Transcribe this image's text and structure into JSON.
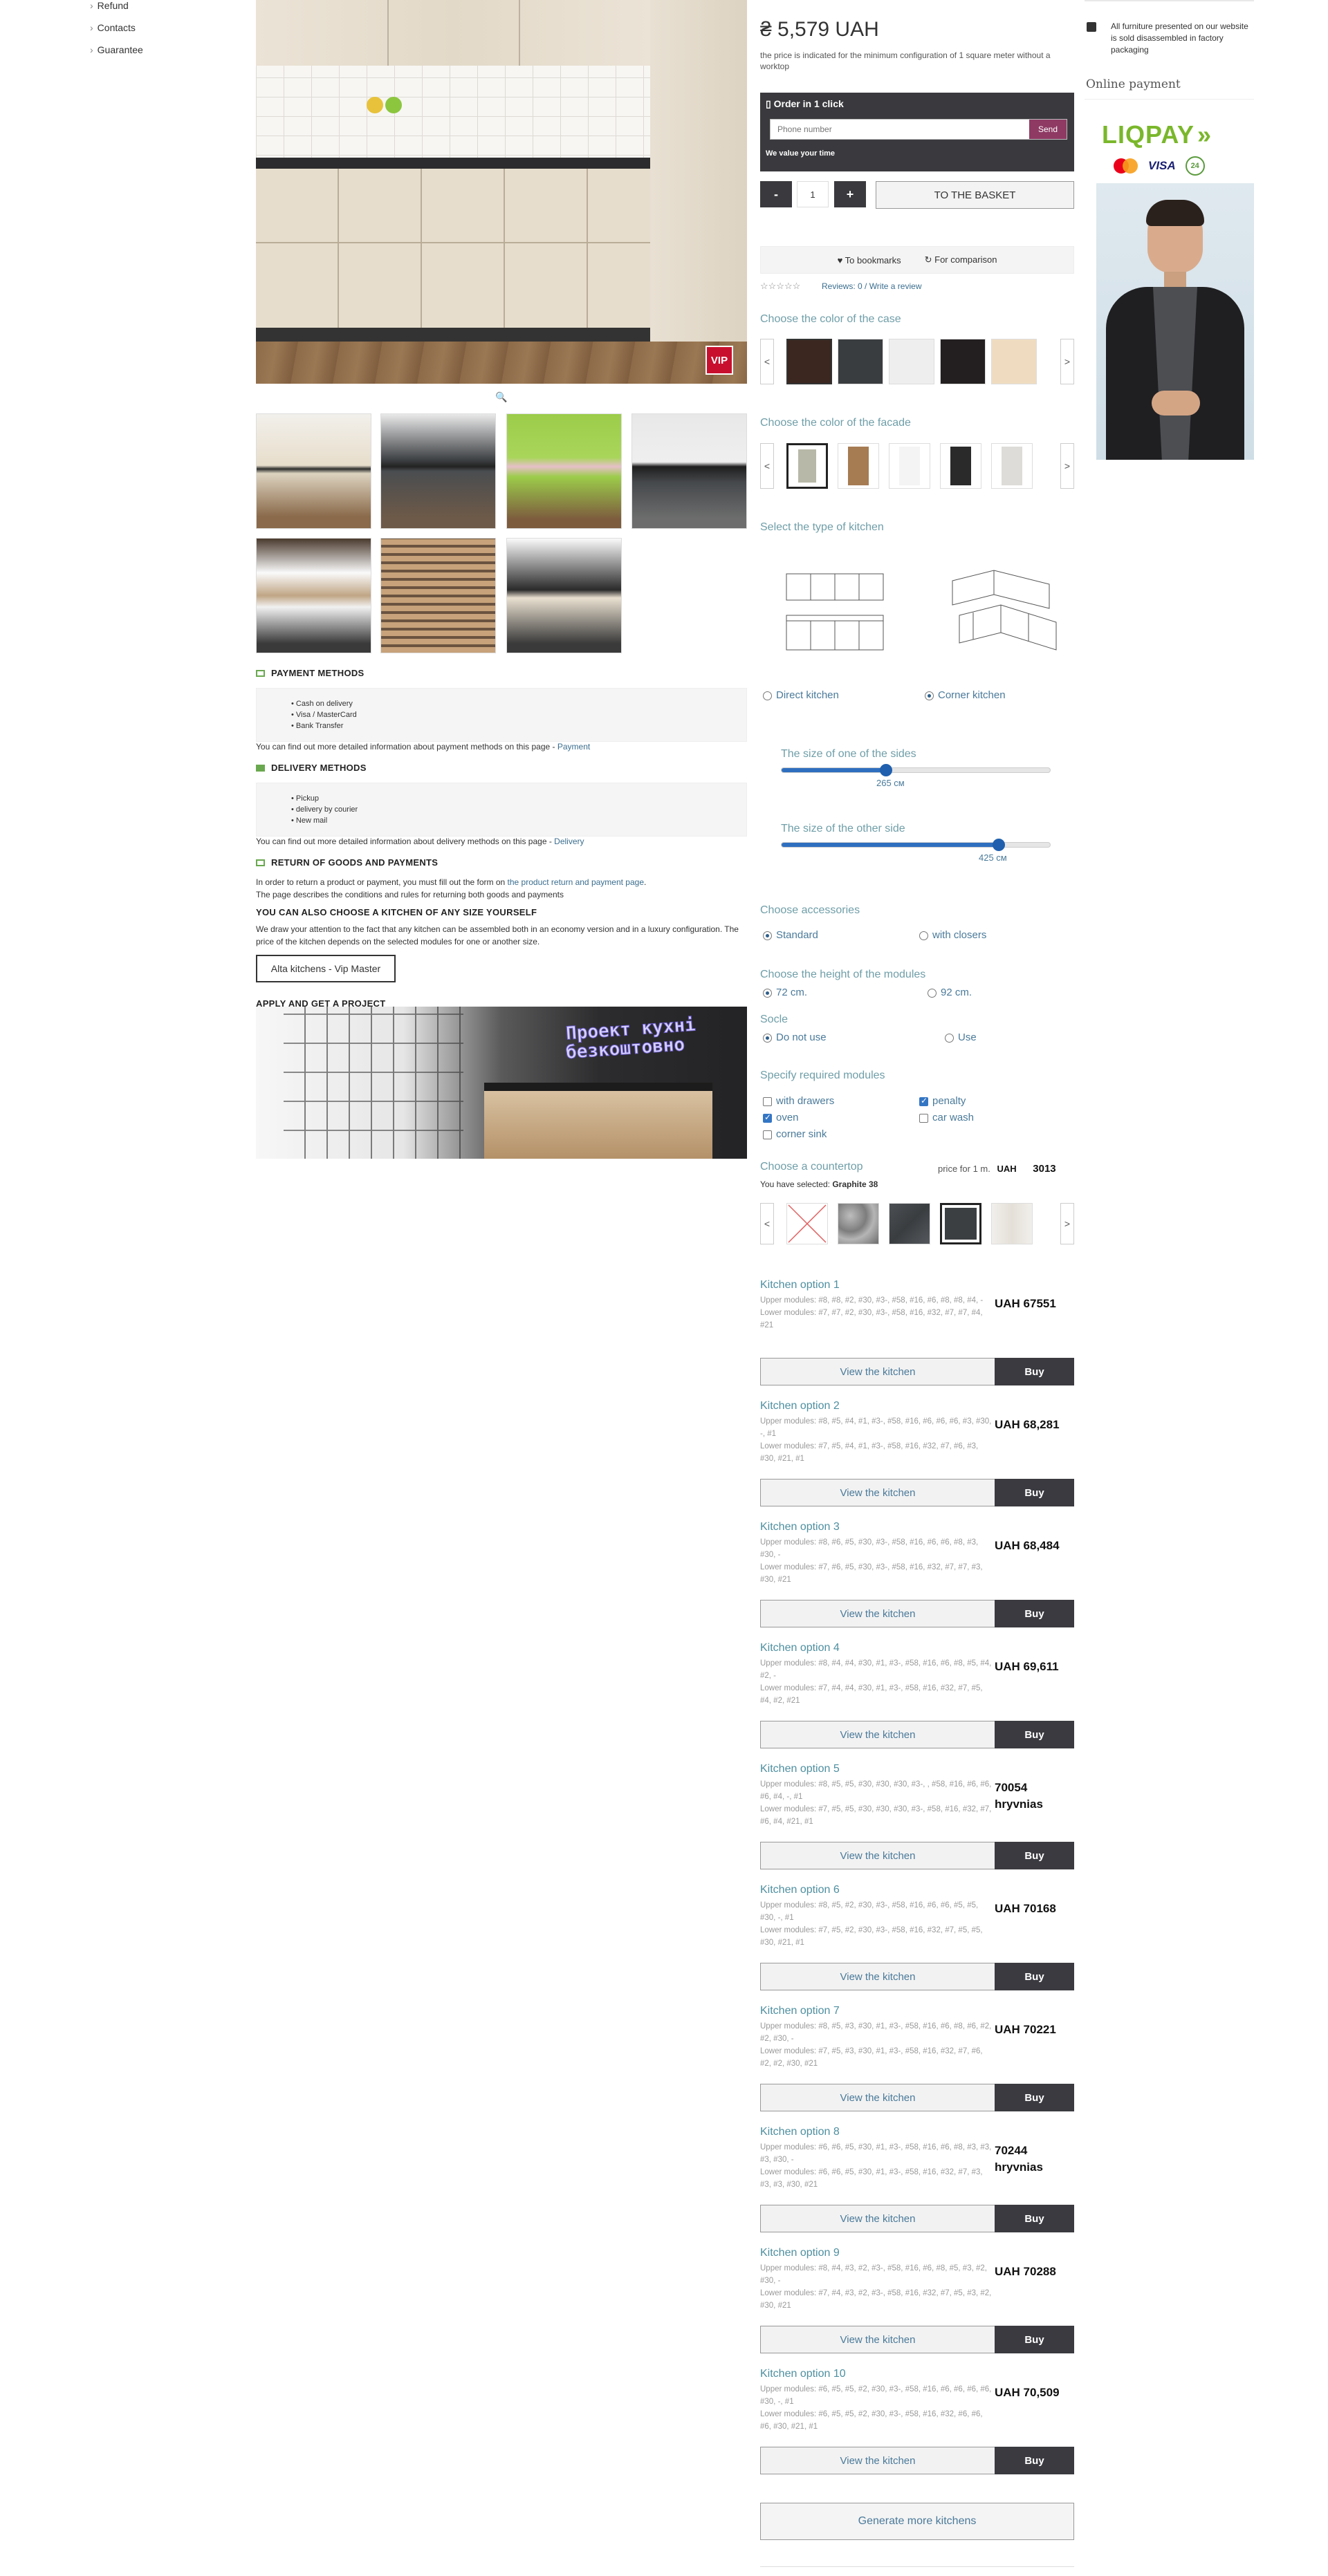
{
  "sidebar": {
    "links": [
      "Refund",
      "Contacts",
      "Guarantee"
    ]
  },
  "gallery": {
    "badge": "VIP",
    "thumbs_count": 7
  },
  "info": {
    "payment_title": "PAYMENT METHODS",
    "payment_items": [
      "Cash on delivery",
      "Visa / MasterCard",
      "Bank Transfer"
    ],
    "payment_note": "You can find out more detailed information about payment methods on this page -",
    "payment_link": "Payment",
    "delivery_title": "DELIVERY METHODS",
    "delivery_items": [
      "Pickup",
      "delivery by courier",
      "New mail"
    ],
    "delivery_note": "You can find out more detailed information about delivery methods on this page -",
    "delivery_link": "Delivery",
    "return_title": "RETURN OF GOODS AND PAYMENTS",
    "return_text1": "In order to return a product or payment, you must fill out the form on",
    "return_link": "the product return and payment page",
    "return_text2": "The page describes the conditions and rules for returning both goods and payments",
    "any_size_title": "YOU CAN ALSO CHOOSE A KITCHEN OF ANY SIZE YOURSELF",
    "any_size_text": "We draw your attention to the fact that any kitchen can be assembled both in an economy version and in a luxury configuration. The price of the kitchen depends on the selected modules for one or another size.",
    "any_size_button": "Alta kitchens - Vip Master",
    "apply_title": "APPLY AND GET A PROJECT",
    "banner_line1": "Проект кухні",
    "banner_line2": "безкоштовно"
  },
  "product": {
    "price": "₴ 5,579 UAH",
    "price_note": "the price is indicated for the minimum configuration of 1 square meter without a worktop",
    "order_title": "Order in 1 click",
    "phone_placeholder": "Phone number",
    "send_label": "Send",
    "value_time": "We value your time",
    "minus": "-",
    "qty": "1",
    "plus": "+",
    "basket": "TO THE BASKET",
    "bookmarks": "To bookmarks",
    "comparison": "For comparison",
    "stars": "☆☆☆☆☆",
    "reviews": "Reviews: 0 / Write a review"
  },
  "colors": {
    "case_title": "Choose the color of the case",
    "case_swatches": [
      "#3b2620",
      "#3a3d3f",
      "#eeeeee",
      "#231f20",
      "#efdcc0"
    ],
    "facade_title": "Choose the color of the facade",
    "facade_swatches": [
      "#b8b8a8",
      "#a67c52",
      "#f4f4f4",
      "#2a2a2a",
      "#dedcd8"
    ],
    "prev": "<",
    "next": ">"
  },
  "kitchen_type": {
    "title": "Select the type of kitchen",
    "direct": "Direct kitchen",
    "corner": "Corner kitchen"
  },
  "sizes": {
    "side1_title": "The size of one of the sides",
    "side1_value": "265 см",
    "side1_level": 0.39,
    "side2_title": "The size of the other side",
    "side2_value": "425 см",
    "side2_level": 0.81
  },
  "accessories": {
    "title": "Choose accessories",
    "standard": "Standard",
    "closers": "with closers"
  },
  "height": {
    "title": "Choose the height of the modules",
    "h72": "72 cm.",
    "h92": "92 cm."
  },
  "socle": {
    "title": "Socle",
    "no": "Do not use",
    "use": "Use"
  },
  "modules": {
    "title": "Specify required modules",
    "items": [
      {
        "label": "with drawers",
        "checked": false
      },
      {
        "label": "penalty",
        "checked": true
      },
      {
        "label": "oven",
        "checked": true
      },
      {
        "label": "car wash",
        "checked": false
      },
      {
        "label": "corner sink",
        "checked": false
      }
    ]
  },
  "countertop": {
    "title": "Choose a countertop",
    "price_label": "price for 1 m.",
    "currency": "UAH",
    "price": "3013",
    "selected_label": "You have selected",
    "selected": "Graphite 38"
  },
  "kitchens": [
    {
      "title": "Kitchen option 1",
      "upper": "Upper modules: #8, #8, #2, #30, #3-, #58, #16, #6, #8, #8, #4, -",
      "lower": "Lower modules: #7, #7, #2, #30, #3-, #58, #16, #32, #7, #7, #4, #21",
      "price": "UAH 67551"
    },
    {
      "title": "Kitchen option 2",
      "upper": "Upper modules: #8, #5, #4, #1, #3-, #58, #16, #6, #6, #6, #3, #30, -, #1",
      "lower": "Lower modules: #7, #5, #4, #1, #3-, #58, #16, #32, #7, #6, #3, #30, #21, #1",
      "price": "UAH 68,281"
    },
    {
      "title": "Kitchen option 3",
      "upper": "Upper modules: #8, #6, #5, #30, #3-, #58, #16, #6, #6, #8, #3, #30, -",
      "lower": "Lower modules: #7, #6, #5, #30, #3-, #58, #16, #32, #7, #7, #3, #30, #21",
      "price": "UAH 68,484"
    },
    {
      "title": "Kitchen option 4",
      "upper": "Upper modules: #8, #4, #4, #30, #1, #3-, #58, #16, #6, #8, #5, #4, #2, -",
      "lower": "Lower modules: #7, #4, #4, #30, #1, #3-, #58, #16, #32, #7, #5, #4, #2, #21",
      "price": "UAH 69,611"
    },
    {
      "title": "Kitchen option 5",
      "upper": "Upper modules: #8, #5, #5, #30, #30, #30, #3-, , #58, #16, #6, #6, #6, #4, -, #1",
      "lower": "Lower modules: #7, #5, #5, #30, #30, #30, #3-, #58, #16, #32, #7, #6, #4, #21, #1",
      "price": "70054 hryvnias"
    },
    {
      "title": "Kitchen option 6",
      "upper": "Upper modules: #8, #5, #2, #30, #3-, #58, #16, #6, #6, #5, #5, #30, -, #1",
      "lower": "Lower modules: #7, #5, #2, #30, #3-, #58, #16, #32, #7, #5, #5, #30, #21, #1",
      "price": "UAH 70168"
    },
    {
      "title": "Kitchen option 7",
      "upper": "Upper modules: #8, #5, #3, #30, #1, #3-, #58, #16, #6, #8, #6, #2, #2, #30, -",
      "lower": "Lower modules: #7, #5, #3, #30, #1, #3-, #58, #16, #32, #7, #6, #2, #2, #30, #21",
      "price": "UAH 70221"
    },
    {
      "title": "Kitchen option 8",
      "upper": "Upper modules: #6, #6, #5, #30, #1, #3-, #58, #16, #6, #8, #3, #3, #3, #30, -",
      "lower": "Lower modules: #6, #6, #5, #30, #1, #3-, #58, #16, #32, #7, #3, #3, #3, #30, #21",
      "price": "70244 hryvnias"
    },
    {
      "title": "Kitchen option 9",
      "upper": "Upper modules: #8, #4, #3, #2, #3-, #58, #16, #6, #8, #5, #3, #2, #30, -",
      "lower": "Lower modules: #7, #4, #3, #2, #3-, #58, #16, #32, #7, #5, #3, #2, #30, #21",
      "price": "UAH 70288"
    },
    {
      "title": "Kitchen option 10",
      "upper": "Upper modules: #6, #5, #5, #2, #30, #3-, #58, #16, #6, #6, #6, #6, #30, -, #1",
      "lower": "Lower modules: #6, #5, #5, #2, #30, #3-, #58, #16, #32, #6, #6, #6, #30, #21, #1",
      "price": "UAH 70,509"
    }
  ],
  "kitchen_buttons": {
    "view": "View the kitchen",
    "buy": "Buy"
  },
  "generate": "Generate more kitchens",
  "right": {
    "furniture_note": "All furniture presented on our website is sold disassembled in factory packaging",
    "online_payment": "Online payment",
    "liqpay": "LIQPAY",
    "card_badge": "24",
    "visa": "VISA"
  }
}
